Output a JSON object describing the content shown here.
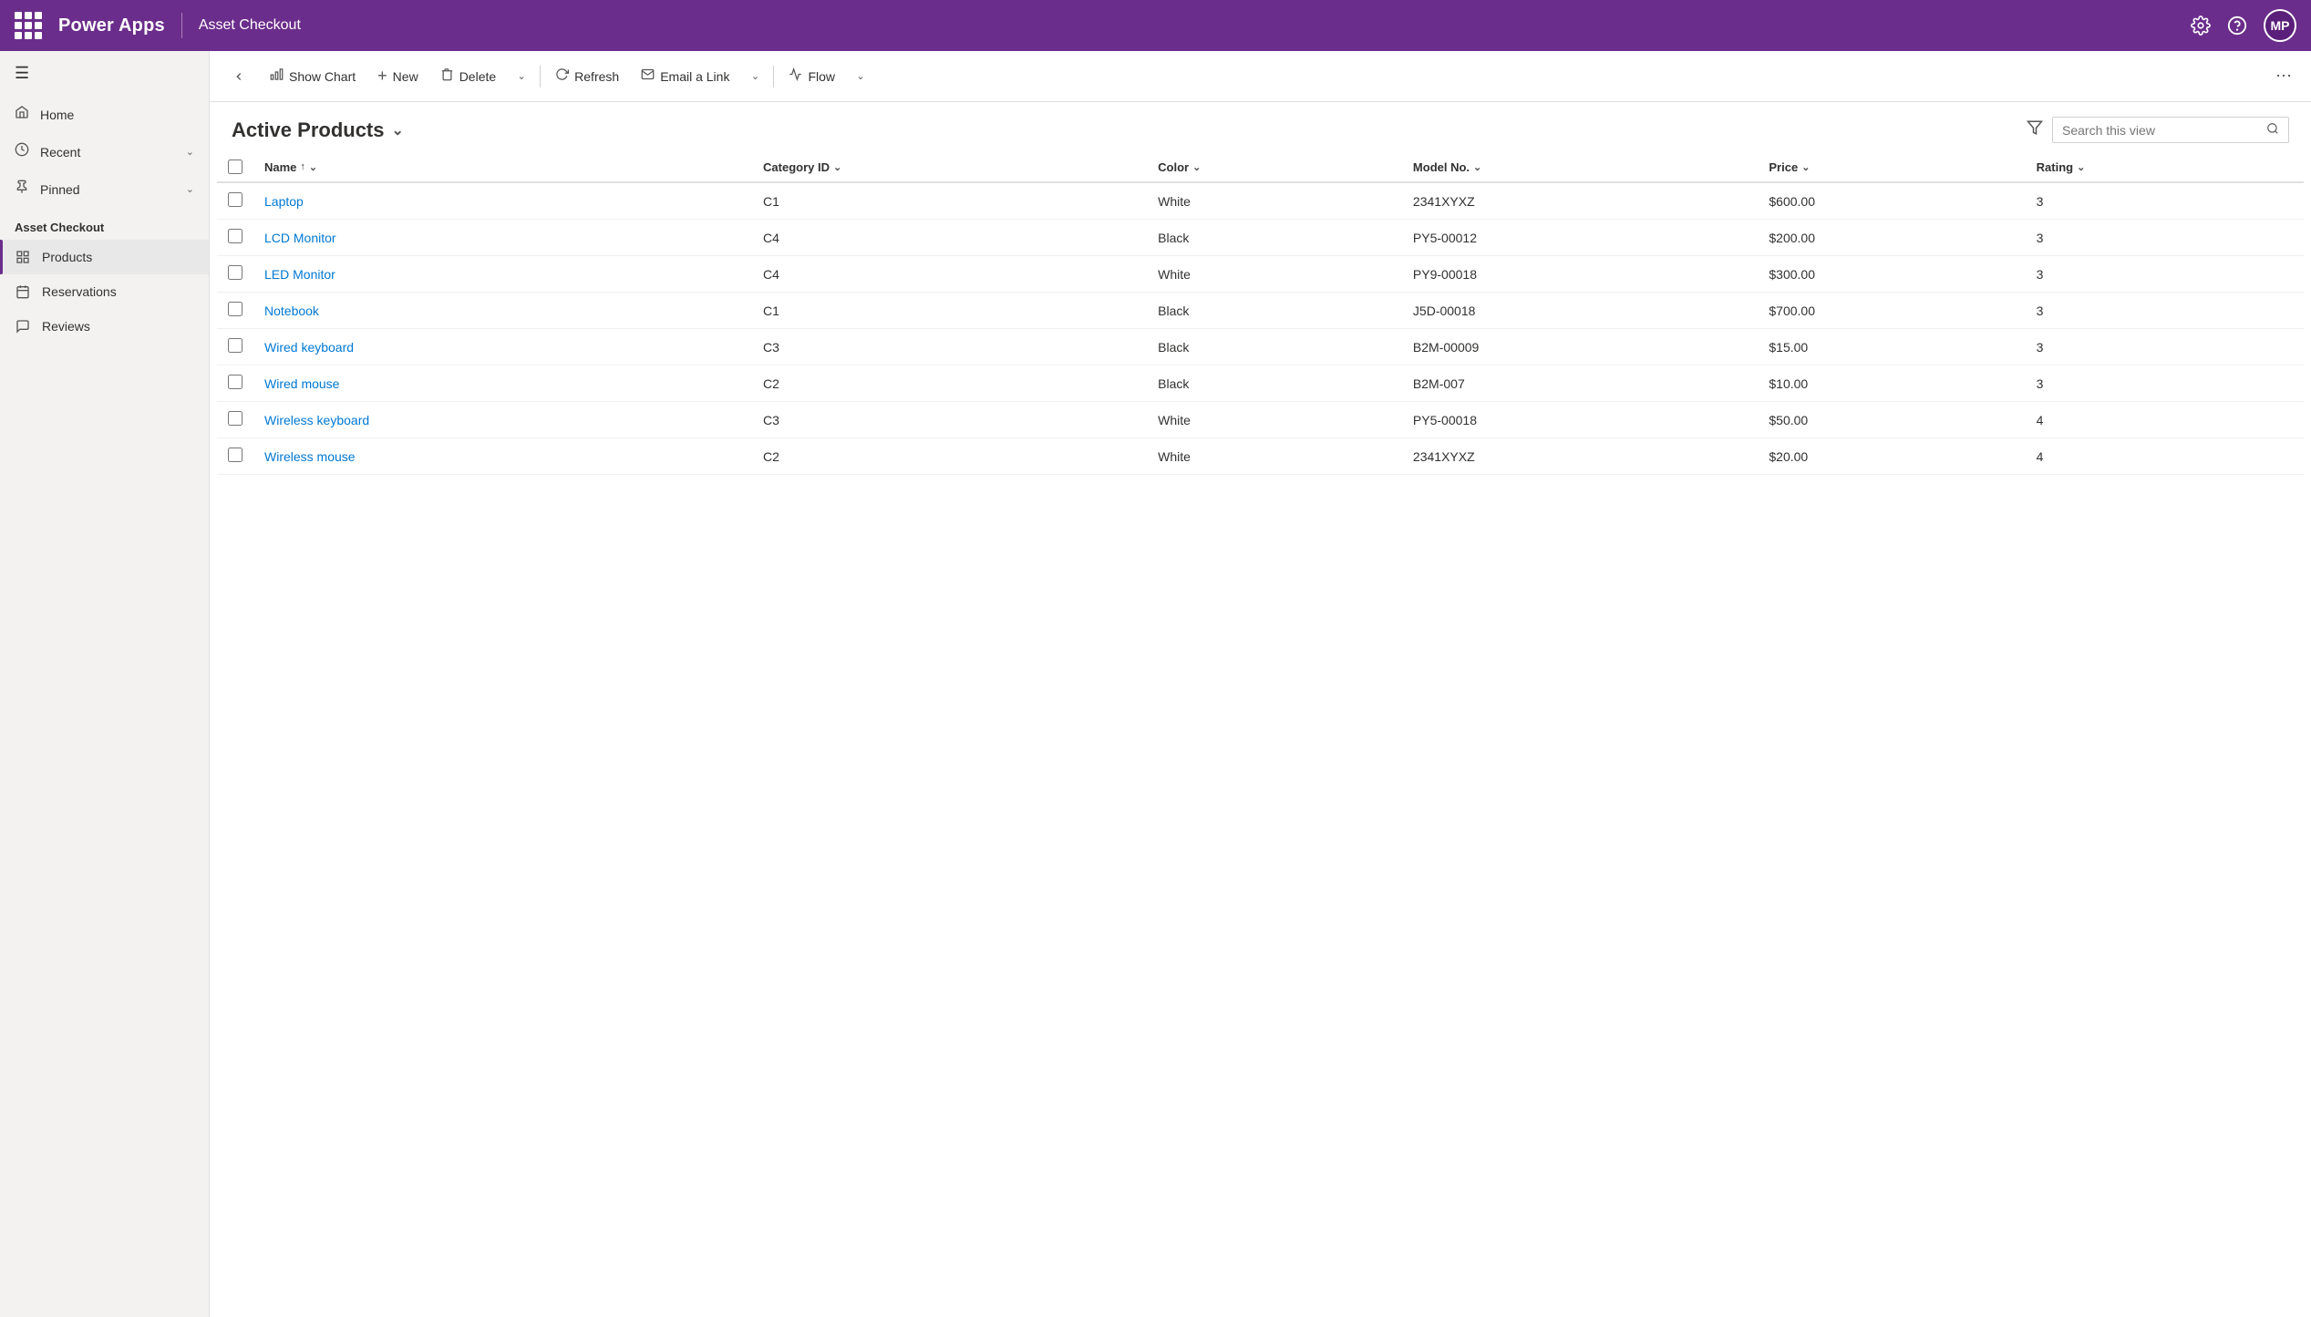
{
  "topbar": {
    "app_name": "Power Apps",
    "page_title": "Asset Checkout",
    "avatar_initials": "MP",
    "dots_label": "apps-grid"
  },
  "sidebar": {
    "nav_items": [
      {
        "id": "home",
        "label": "Home",
        "icon": "⌂",
        "has_chevron": false
      },
      {
        "id": "recent",
        "label": "Recent",
        "icon": "⏱",
        "has_chevron": true
      },
      {
        "id": "pinned",
        "label": "Pinned",
        "icon": "📌",
        "has_chevron": true
      }
    ],
    "section_label": "Asset Checkout",
    "entity_items": [
      {
        "id": "products",
        "label": "Products",
        "icon": "📋",
        "active": true
      },
      {
        "id": "reservations",
        "label": "Reservations",
        "icon": "📋",
        "active": false
      },
      {
        "id": "reviews",
        "label": "Reviews",
        "icon": "📋",
        "active": false
      }
    ]
  },
  "commandbar": {
    "back_title": "Back",
    "show_chart_label": "Show Chart",
    "new_label": "New",
    "delete_label": "Delete",
    "refresh_label": "Refresh",
    "email_link_label": "Email a Link",
    "flow_label": "Flow",
    "more_title": "More"
  },
  "view": {
    "title": "Active Products",
    "search_placeholder": "Search this view"
  },
  "table": {
    "columns": [
      {
        "id": "name",
        "label": "Name",
        "sort": "asc",
        "has_sort_chevron": true
      },
      {
        "id": "category_id",
        "label": "Category ID",
        "has_chevron": true
      },
      {
        "id": "color",
        "label": "Color",
        "has_chevron": true
      },
      {
        "id": "model_no",
        "label": "Model No.",
        "has_chevron": true
      },
      {
        "id": "price",
        "label": "Price",
        "has_chevron": true
      },
      {
        "id": "rating",
        "label": "Rating",
        "has_chevron": true
      }
    ],
    "rows": [
      {
        "name": "Laptop",
        "category_id": "C1",
        "color": "White",
        "model_no": "2341XYXZ",
        "price": "$600.00",
        "rating": "3"
      },
      {
        "name": "LCD Monitor",
        "category_id": "C4",
        "color": "Black",
        "model_no": "PY5-00012",
        "price": "$200.00",
        "rating": "3"
      },
      {
        "name": "LED Monitor",
        "category_id": "C4",
        "color": "White",
        "model_no": "PY9-00018",
        "price": "$300.00",
        "rating": "3"
      },
      {
        "name": "Notebook",
        "category_id": "C1",
        "color": "Black",
        "model_no": "J5D-00018",
        "price": "$700.00",
        "rating": "3"
      },
      {
        "name": "Wired keyboard",
        "category_id": "C3",
        "color": "Black",
        "model_no": "B2M-00009",
        "price": "$15.00",
        "rating": "3"
      },
      {
        "name": "Wired mouse",
        "category_id": "C2",
        "color": "Black",
        "model_no": "B2M-007",
        "price": "$10.00",
        "rating": "3"
      },
      {
        "name": "Wireless keyboard",
        "category_id": "C3",
        "color": "White",
        "model_no": "PY5-00018",
        "price": "$50.00",
        "rating": "4"
      },
      {
        "name": "Wireless mouse",
        "category_id": "C2",
        "color": "White",
        "model_no": "2341XYXZ",
        "price": "$20.00",
        "rating": "4"
      }
    ]
  }
}
